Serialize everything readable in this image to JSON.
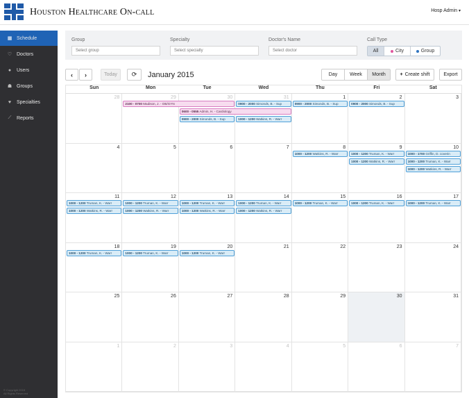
{
  "app": {
    "brand": "Houston Healthcare On-call",
    "user_menu": "Hosp Admin"
  },
  "sidebar": {
    "items": [
      {
        "label": "Schedule",
        "icon": "calendar-icon",
        "glyph": "▦",
        "active": true
      },
      {
        "label": "Doctors",
        "icon": "stethoscope-icon",
        "glyph": "♡",
        "active": false
      },
      {
        "label": "Users",
        "icon": "user-icon",
        "glyph": "●",
        "active": false
      },
      {
        "label": "Groups",
        "icon": "users-icon",
        "glyph": "☗",
        "active": false
      },
      {
        "label": "Specialties",
        "icon": "heart-icon",
        "glyph": "♥",
        "active": false
      },
      {
        "label": "Reports",
        "icon": "chart-icon",
        "glyph": "⟋",
        "active": false
      }
    ],
    "copyright": [
      "© Copyright 2015",
      "All Rights Reserved"
    ]
  },
  "filters": {
    "group": {
      "label": "Group",
      "placeholder": "Select group"
    },
    "specialty": {
      "label": "Specialty",
      "placeholder": "Select specialty"
    },
    "doctor": {
      "label": "Doctor's Name",
      "placeholder": "Select doctor"
    },
    "call_type": {
      "label": "Call Type",
      "options": [
        {
          "label": "All",
          "selected": true,
          "dot": null
        },
        {
          "label": "City",
          "selected": false,
          "dot": "#e0569e"
        },
        {
          "label": "Group",
          "selected": false,
          "dot": "#2f74c0"
        }
      ]
    }
  },
  "toolbar": {
    "today": "Today",
    "month_title": "January 2015",
    "views": [
      {
        "label": "Day",
        "selected": false
      },
      {
        "label": "Week",
        "selected": false
      },
      {
        "label": "Month",
        "selected": true
      }
    ],
    "create_shift": "Create shift",
    "export": "Export"
  },
  "calendar": {
    "days_of_week": [
      "Sun",
      "Mon",
      "Tue",
      "Wed",
      "Thu",
      "Fri",
      "Sat"
    ],
    "today_date": 30,
    "weeks": [
      [
        {
          "d": "28",
          "o": true
        },
        {
          "d": "29",
          "o": true
        },
        {
          "d": "30",
          "o": true
        },
        {
          "d": "31",
          "o": true
        },
        {
          "d": "1"
        },
        {
          "d": "2"
        },
        {
          "d": "3"
        }
      ],
      [
        {
          "d": "4"
        },
        {
          "d": "5"
        },
        {
          "d": "6"
        },
        {
          "d": "7"
        },
        {
          "d": "8"
        },
        {
          "d": "9"
        },
        {
          "d": "10"
        }
      ],
      [
        {
          "d": "11"
        },
        {
          "d": "12"
        },
        {
          "d": "13"
        },
        {
          "d": "14"
        },
        {
          "d": "15"
        },
        {
          "d": "16"
        },
        {
          "d": "17"
        }
      ],
      [
        {
          "d": "18"
        },
        {
          "d": "19"
        },
        {
          "d": "20"
        },
        {
          "d": "21"
        },
        {
          "d": "22"
        },
        {
          "d": "23"
        },
        {
          "d": "24"
        }
      ],
      [
        {
          "d": "25"
        },
        {
          "d": "26"
        },
        {
          "d": "27"
        },
        {
          "d": "28"
        },
        {
          "d": "29"
        },
        {
          "d": "30"
        },
        {
          "d": "31"
        }
      ],
      [
        {
          "d": "1",
          "o": true
        },
        {
          "d": "2",
          "o": true
        },
        {
          "d": "3",
          "o": true
        },
        {
          "d": "4",
          "o": true
        },
        {
          "d": "5",
          "o": true
        },
        {
          "d": "6",
          "o": true
        },
        {
          "d": "7",
          "o": true
        }
      ]
    ],
    "events": [
      {
        "week": 0,
        "day": 1,
        "span": 2,
        "slot": 0,
        "time": "2100 - 0700",
        "text": "Madison, J. - OB/GYN",
        "kind": "pink"
      },
      {
        "week": 0,
        "day": 2,
        "span": 2,
        "slot": 1,
        "time": "0600 - 0555",
        "text": "Admin, H. - Cardiology",
        "kind": "pink"
      },
      {
        "week": 0,
        "day": 2,
        "span": 1,
        "slot": 2,
        "time": "0900 - 2000",
        "text": "Simonds, B. - Sup",
        "kind": "blue"
      },
      {
        "week": 0,
        "day": 3,
        "span": 1,
        "slot": 0,
        "time": "0900 - 2000",
        "text": "Simonds, B. - Sup",
        "kind": "blue"
      },
      {
        "week": 0,
        "day": 3,
        "span": 1,
        "slot": 2,
        "time": "1000 - 1200",
        "text": "Watkins, R. - Warr",
        "kind": "blue"
      },
      {
        "week": 0,
        "day": 4,
        "span": 1,
        "slot": 0,
        "time": "0900 - 2000",
        "text": "Simonds, B. - Sup",
        "kind": "blue"
      },
      {
        "week": 0,
        "day": 5,
        "span": 1,
        "slot": 0,
        "time": "0900 - 2000",
        "text": "Simonds, B. - Sup",
        "kind": "blue"
      },
      {
        "week": 1,
        "day": 4,
        "span": 1,
        "slot": 0,
        "time": "1000 - 1200",
        "text": "Watkins, R. - Warr",
        "kind": "blue"
      },
      {
        "week": 1,
        "day": 5,
        "span": 1,
        "slot": 0,
        "time": "1000 - 1200",
        "text": "Truman, K. - Warr",
        "kind": "blue"
      },
      {
        "week": 1,
        "day": 5,
        "span": 1,
        "slot": 1,
        "time": "1000 - 1200",
        "text": "Watkins, R. - Warr",
        "kind": "blue"
      },
      {
        "week": 1,
        "day": 6,
        "span": 1,
        "slot": 0,
        "time": "1000 - 1700",
        "text": "Griffin, D. coverin",
        "kind": "blue"
      },
      {
        "week": 1,
        "day": 6,
        "span": 1,
        "slot": 1,
        "time": "1000 - 1200",
        "text": "Truman, K. - Warr",
        "kind": "blue"
      },
      {
        "week": 1,
        "day": 6,
        "span": 1,
        "slot": 2,
        "time": "1000 - 1200",
        "text": "Watkins, R. - Warr",
        "kind": "blue"
      },
      {
        "week": 2,
        "day": 0,
        "span": 1,
        "slot": 0,
        "time": "1000 - 1200",
        "text": "Truman, K. - Warr",
        "kind": "blue"
      },
      {
        "week": 2,
        "day": 0,
        "span": 1,
        "slot": 1,
        "time": "1000 - 1200",
        "text": "Watkins, R. - Warr",
        "kind": "blue"
      },
      {
        "week": 2,
        "day": 1,
        "span": 1,
        "slot": 0,
        "time": "1000 - 1200",
        "text": "Truman, K. - Warr",
        "kind": "blue"
      },
      {
        "week": 2,
        "day": 1,
        "span": 1,
        "slot": 1,
        "time": "1000 - 1200",
        "text": "Watkins, R. - Warr",
        "kind": "blue"
      },
      {
        "week": 2,
        "day": 2,
        "span": 1,
        "slot": 0,
        "time": "1000 - 1200",
        "text": "Truman, K. - Warr",
        "kind": "blue"
      },
      {
        "week": 2,
        "day": 2,
        "span": 1,
        "slot": 1,
        "time": "1000 - 1200",
        "text": "Watkins, R. - Warr",
        "kind": "blue"
      },
      {
        "week": 2,
        "day": 3,
        "span": 1,
        "slot": 0,
        "time": "1000 - 1200",
        "text": "Truman, K. - Warr",
        "kind": "blue"
      },
      {
        "week": 2,
        "day": 3,
        "span": 1,
        "slot": 1,
        "time": "1000 - 1200",
        "text": "Watkins, R. - Warr",
        "kind": "blue"
      },
      {
        "week": 2,
        "day": 4,
        "span": 1,
        "slot": 0,
        "time": "1000 - 1200",
        "text": "Truman, K. - Warr",
        "kind": "blue"
      },
      {
        "week": 2,
        "day": 5,
        "span": 1,
        "slot": 0,
        "time": "1000 - 1200",
        "text": "Truman, K. - Warr",
        "kind": "blue"
      },
      {
        "week": 2,
        "day": 6,
        "span": 1,
        "slot": 0,
        "time": "1000 - 1200",
        "text": "Truman, K. - Warr",
        "kind": "blue"
      },
      {
        "week": 3,
        "day": 0,
        "span": 1,
        "slot": 0,
        "time": "1000 - 1200",
        "text": "Truman, K. - Warr",
        "kind": "blue"
      },
      {
        "week": 3,
        "day": 1,
        "span": 1,
        "slot": 0,
        "time": "1000 - 1200",
        "text": "Truman, K. - Warr",
        "kind": "blue"
      },
      {
        "week": 3,
        "day": 2,
        "span": 1,
        "slot": 0,
        "time": "1000 - 1200",
        "text": "Truman, K. - Warr",
        "kind": "blue"
      }
    ]
  }
}
